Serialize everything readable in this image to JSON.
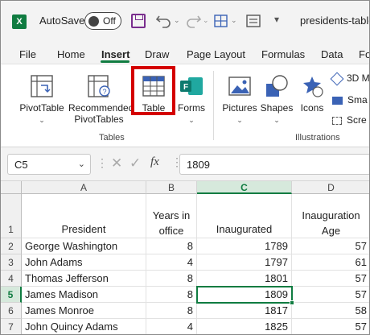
{
  "titlebar": {
    "app_logo": "X",
    "autosave_label": "AutoSave",
    "autosave_state": "Off",
    "doc_title": "presidents-table"
  },
  "menu": {
    "items": [
      "File",
      "Home",
      "Insert",
      "Draw",
      "Page Layout",
      "Formulas",
      "Data",
      "Fo"
    ],
    "active": "Insert",
    "accent_color": "#107c41"
  },
  "ribbon": {
    "tables_group": {
      "label": "Tables",
      "pivottable": "PivotTable",
      "recommended_line1": "Recommended",
      "recommended_line2": "PivotTables",
      "table": "Table"
    },
    "forms": "Forms",
    "illustrations_group": {
      "label": "Illustrations",
      "pictures": "Pictures",
      "shapes": "Shapes",
      "icons": "Icons",
      "models_3d": "3D M",
      "smartart": "Sma",
      "screenshot": "Scre"
    },
    "highlight_color": "#d40000"
  },
  "formula_bar": {
    "name_box": "C5",
    "fx": "fx",
    "value": "1809"
  },
  "sheet": {
    "columns": [
      "A",
      "B",
      "C",
      "D"
    ],
    "selected_column": "C",
    "rows": [
      "1",
      "2",
      "3",
      "4",
      "5",
      "6",
      "7"
    ],
    "selected_row": "5",
    "header": {
      "a": "President",
      "b_line1": "Years in",
      "b_line2": "office",
      "c": "Inaugurated",
      "d_line1": "Inauguration",
      "d_line2": "Age"
    },
    "data": [
      {
        "president": "George Washington",
        "years": "8",
        "inaugurated": "1789",
        "age": "57"
      },
      {
        "president": "John Adams",
        "years": "4",
        "inaugurated": "1797",
        "age": "61"
      },
      {
        "president": "Thomas Jefferson",
        "years": "8",
        "inaugurated": "1801",
        "age": "57"
      },
      {
        "president": "James Madison",
        "years": "8",
        "inaugurated": "1809",
        "age": "57"
      },
      {
        "president": "James Monroe",
        "years": "8",
        "inaugurated": "1817",
        "age": "58"
      },
      {
        "president": "John Quincy Adams",
        "years": "4",
        "inaugurated": "1825",
        "age": "57"
      }
    ]
  }
}
